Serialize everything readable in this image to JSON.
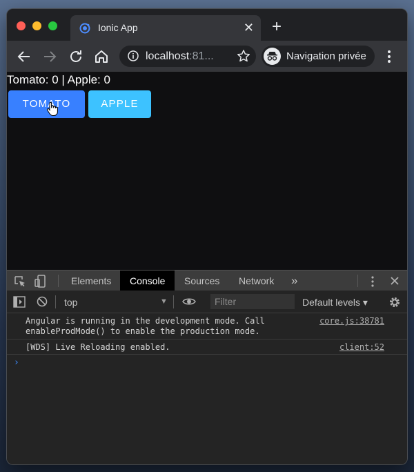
{
  "browser": {
    "tab_title": "Ionic App",
    "tab_close": "✕",
    "new_tab": "+",
    "url_host": "localhost",
    "url_rest": ":81...",
    "incognito_label": "Navigation privée",
    "icons": [
      "back-icon",
      "forward-icon",
      "reload-icon",
      "home-icon",
      "info-icon",
      "star-icon",
      "incognito-icon",
      "menu-dots-icon"
    ]
  },
  "app": {
    "counter_text": "Tomato: 0 | Apple: 0",
    "tomato_button": "TOMATO",
    "apple_button": "APPLE",
    "colors": {
      "tomato": "#3880ff",
      "apple": "#3dc2ff"
    }
  },
  "devtools": {
    "tabs": [
      "Elements",
      "Console",
      "Sources",
      "Network"
    ],
    "more_tabs": "»",
    "active_tab": "Console",
    "context": "top",
    "filter_placeholder": "Filter",
    "levels": "Default levels ▾",
    "messages": [
      {
        "text": "Angular is running in the development mode. Call\nenableProdMode() to enable the production mode.",
        "source": "core.js:38781"
      },
      {
        "text": "[WDS] Live Reloading enabled.",
        "source": "client:52"
      }
    ],
    "prompt": "›"
  }
}
